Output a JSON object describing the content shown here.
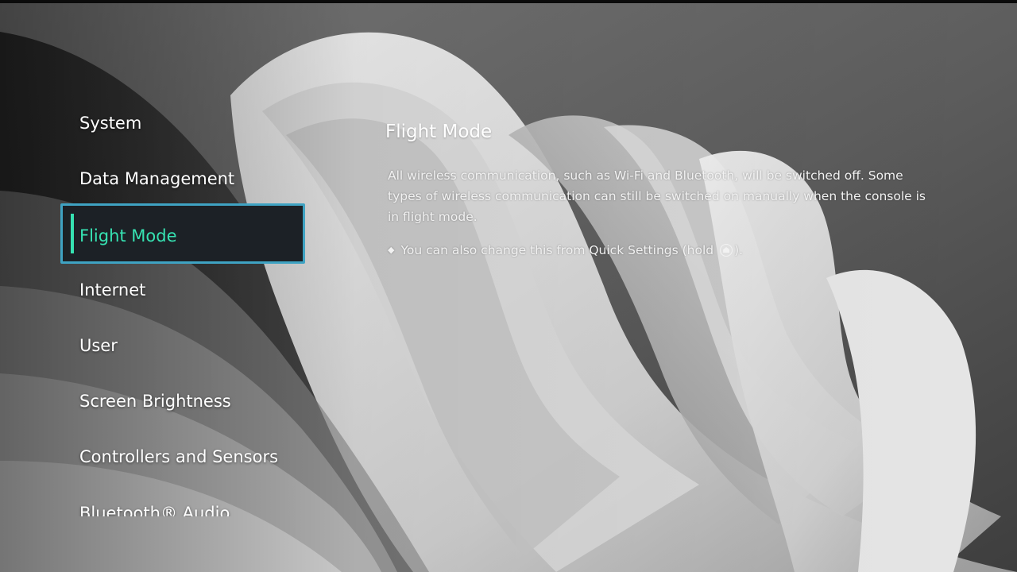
{
  "menu": {
    "items": [
      {
        "label": "System",
        "active": false
      },
      {
        "label": "Data Management",
        "active": false
      },
      {
        "label": "Flight Mode",
        "active": true
      },
      {
        "label": "Internet",
        "active": false
      },
      {
        "label": "User",
        "active": false
      },
      {
        "label": "Screen Brightness",
        "active": false
      },
      {
        "label": "Controllers and Sensors",
        "active": false
      },
      {
        "label": "Bluetooth® Audio",
        "active": false
      }
    ]
  },
  "detail": {
    "title": "Flight Mode",
    "description": "All wireless communication, such as Wi-Fi and Bluetooth, will be switched off. Some types of wireless communication can still be switched on manually when the console is in flight mode.",
    "note_prefix": "You can also change this from Quick Settings (hold",
    "note_suffix": ")."
  },
  "colors": {
    "accent": "#36e2b2",
    "selection_border": "#3fa3c3",
    "selection_bg": "#1c2126"
  },
  "icons": {
    "note_bullet": "diamond-bullet-icon",
    "home_button": "home-button-icon"
  }
}
